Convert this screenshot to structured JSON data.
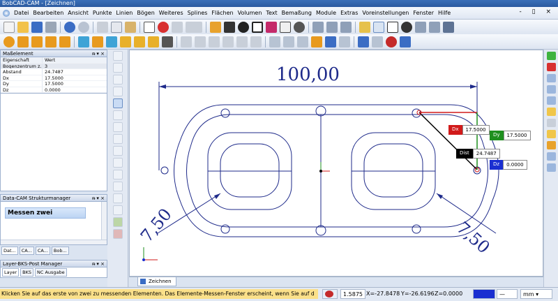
{
  "window": {
    "title": "BobCAD-CAM - [Zeichnen]",
    "controls": "- ▯ ×"
  },
  "menu": [
    "Datei",
    "Bearbeiten",
    "Ansicht",
    "Punkte",
    "Linien",
    "Bögen",
    "Weiteres",
    "Splines",
    "Flächen",
    "Volumen",
    "Text",
    "Bemaßung",
    "Module",
    "Extras",
    "Voreinstellungen",
    "Fenster",
    "Hilfe"
  ],
  "props_panel": {
    "title": "Maßelement",
    "col_property": "Eigenschaft",
    "col_value": "Wert",
    "rows": [
      {
        "name": "Bogenzentrum z...",
        "value": "3"
      },
      {
        "name": "Abstand",
        "value": "24.7487"
      },
      {
        "name": "Dx",
        "value": "17.5000"
      },
      {
        "name": "Dy",
        "value": "17.5000"
      },
      {
        "name": "Dz",
        "value": "0.0000"
      }
    ],
    "pin": "ᵰ ▾ ×"
  },
  "struct_panel": {
    "title": "Data-CAM Strukturmanager",
    "item": "Messen zwei",
    "tabs": [
      "Dat...",
      "CA...",
      "CA...",
      "Bob..."
    ]
  },
  "layer_panel": {
    "title": "Layer-BKS-Post Manager",
    "tabs": [
      "Layer",
      "BKS",
      "NC Ausgabe"
    ]
  },
  "drawing": {
    "dim_top": "100,00",
    "dim_left": "7,50",
    "dim_right": "7,50",
    "tab": "Zeichnen"
  },
  "measure": {
    "dx_label": "Dx",
    "dx_value": "17.5000",
    "dy_label": "Dy",
    "dy_value": "17.5000",
    "dist_label": "Dist",
    "dist_value": "24.7487",
    "dz_label": "Dz",
    "dz_value": "0.0000"
  },
  "status": {
    "message": "Klicken Sie auf das erste von zwei zu messenden Elementen. Das Elemente-Messen-Fenster erscheint, wenn Sie auf d",
    "step": "1.5875",
    "x": "X=-27.8478",
    "y": "Y=-26.6196",
    "z": "Z=0.0000",
    "unit": "mm"
  },
  "colors": {
    "menu_bg": "#dfe7f3",
    "drawing_line": "#1e2a8a",
    "status_msg_bg": "#fbe08a",
    "dx": "#d11a1a",
    "dy": "#1e8f1e",
    "dist": "#000000",
    "dz": "#1a2fd1"
  }
}
